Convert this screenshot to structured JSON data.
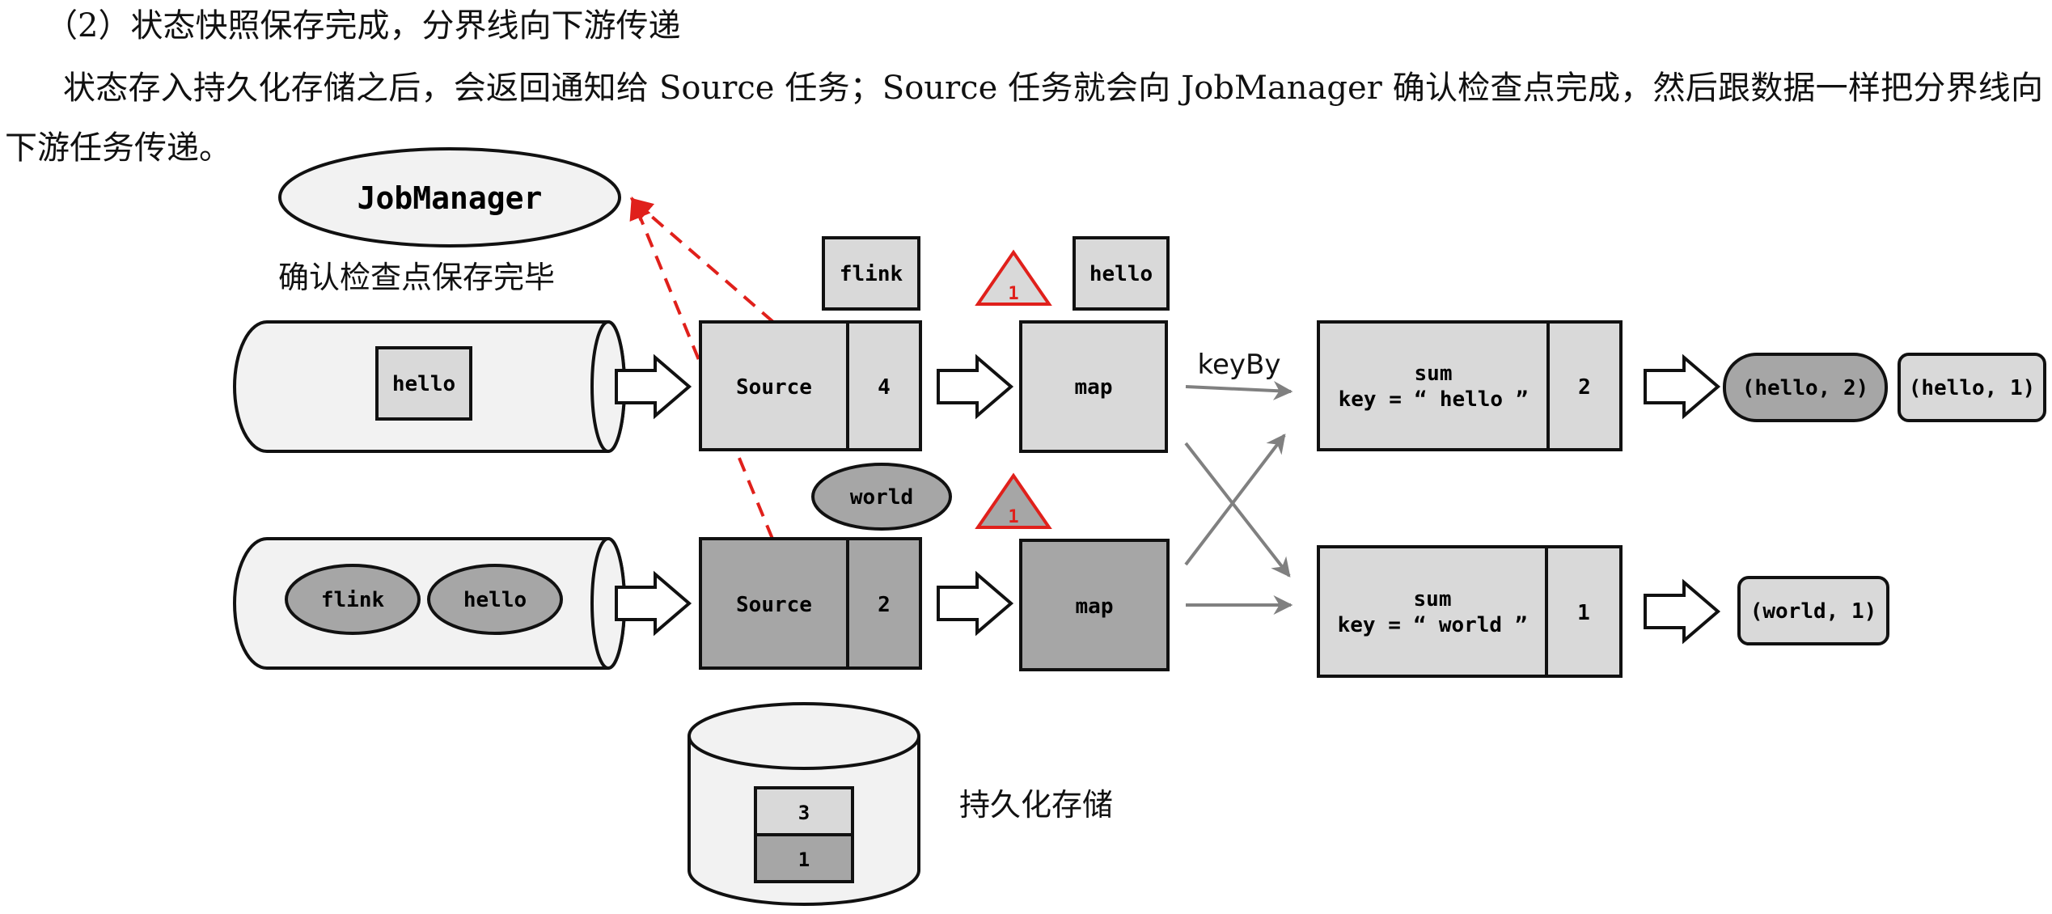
{
  "text": {
    "heading": "（2）状态快照保存完成，分界线向下游传递",
    "paragraph": "状态存入持久化存储之后，会返回通知给 Source 任务；Source 任务就会向 JobManager 确认检查点完成，然后跟数据一样把分界线向下游任务传递。"
  },
  "diagram": {
    "jobmanager": "JobManager",
    "confirm_label": "确认检查点保存完毕",
    "storage_label": "持久化存储",
    "keyby_label": "keyBy",
    "barrier_id": "1",
    "upper": {
      "queue_item": "hello",
      "source_label": "Source",
      "source_state": "4",
      "incoming_token": "flink",
      "map_label": "map",
      "map_token": "hello",
      "sum_line1": "sum",
      "sum_line2": "key = “ hello ”",
      "sum_state": "2",
      "outputs": [
        "(hello, 2)",
        "(hello, 1)"
      ]
    },
    "lower": {
      "queue_items": [
        "flink",
        "hello"
      ],
      "source_label": "Source",
      "source_state": "2",
      "incoming_token": "world",
      "map_label": "map",
      "sum_line1": "sum",
      "sum_line2": "key = “ world ”",
      "sum_state": "1",
      "outputs": [
        "(world, 1)"
      ]
    },
    "storage_values": [
      "3",
      "1"
    ],
    "colors": {
      "light_fill": "#d9d9d9",
      "dark_fill": "#a6a6a6",
      "queue_fill": "#f2f2f2",
      "barrier_red": "#e0201b",
      "arrow_gray": "#808080"
    }
  }
}
